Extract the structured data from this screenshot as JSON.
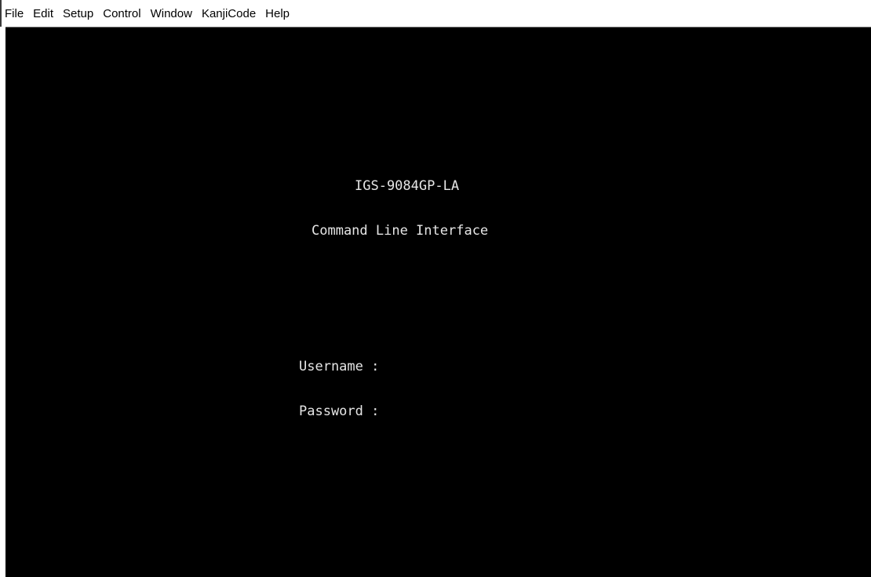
{
  "menubar": {
    "items": [
      {
        "label": "File"
      },
      {
        "label": "Edit"
      },
      {
        "label": "Setup"
      },
      {
        "label": "Control"
      },
      {
        "label": "Window"
      },
      {
        "label": "KanjiCode"
      },
      {
        "label": "Help"
      }
    ]
  },
  "terminal": {
    "title": "IGS-9084GP-LA",
    "subtitle": "Command Line Interface",
    "username_prompt": "Username :",
    "password_prompt": "Password :",
    "username_value": "",
    "password_value": "",
    "background_color": "#000000",
    "text_color": "#e6e6e6"
  }
}
